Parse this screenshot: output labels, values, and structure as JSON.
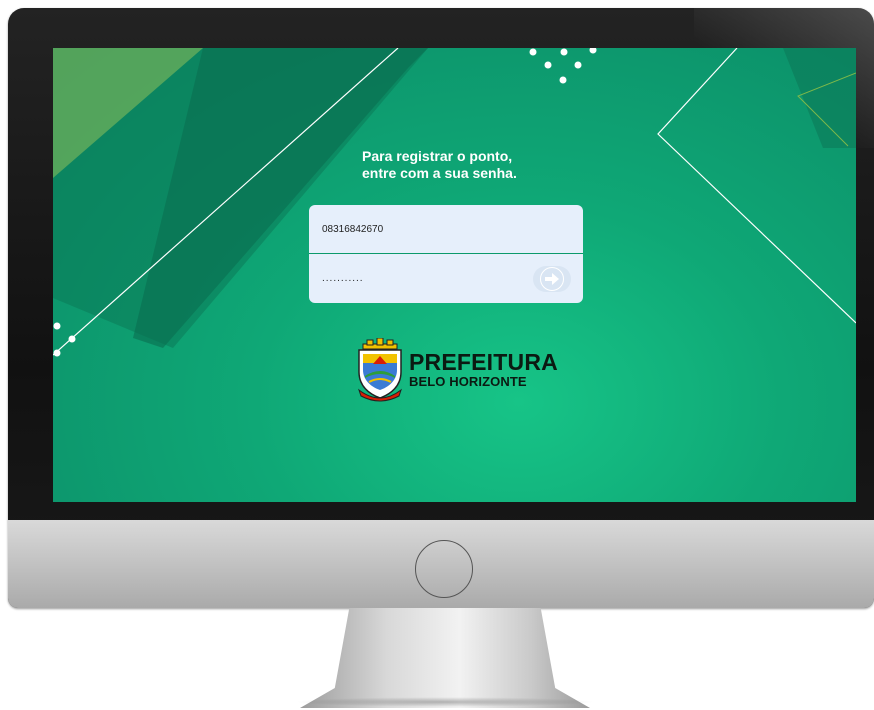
{
  "login": {
    "headline_line1": "Para registrar o ponto,",
    "headline_line2": "entre com a sua senha.",
    "username_value": "08316842670",
    "password_value": "...........",
    "submit_icon": "arrow-right-icon"
  },
  "logo": {
    "line1": "PREFEITURA",
    "line2": "BELO HORIZONTE",
    "icon": "city-crest-icon"
  },
  "colors": {
    "screen_bg": "#0fa876",
    "screen_dark": "#0b8a66",
    "field_bg": "#e6effb",
    "text_dark": "#0b1a12"
  }
}
